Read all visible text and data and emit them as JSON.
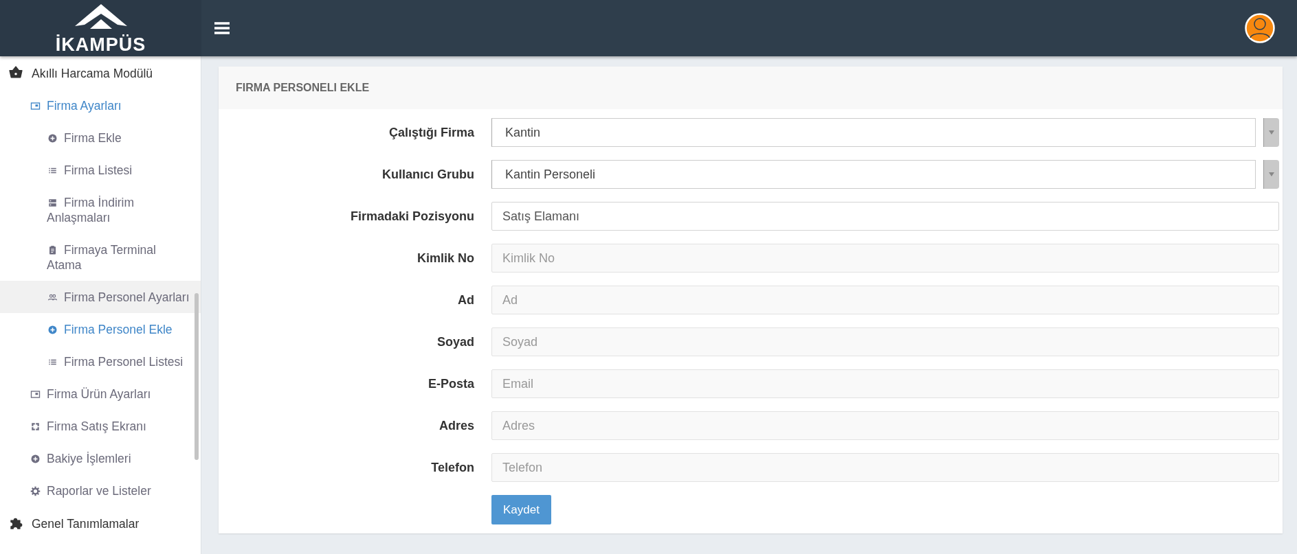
{
  "logo": {
    "text": "İKAMPÜS"
  },
  "sidebar": {
    "items": [
      {
        "label": "Akıllı Harcama Modülü",
        "active": false,
        "highlighted": false,
        "children": [
          {
            "label": "Firma Ayarları",
            "active": true,
            "highlighted": false,
            "children": [
              {
                "label": "Firma Ekle",
                "active": false,
                "highlighted": false
              },
              {
                "label": "Firma Listesi",
                "active": false,
                "highlighted": false
              },
              {
                "label": "Firma İndirim Anlaşmaları",
                "active": false,
                "highlighted": false
              },
              {
                "label": "Firmaya Terminal Atama",
                "active": false,
                "highlighted": false
              },
              {
                "label": "Firma Personel Ayarları",
                "active": false,
                "highlighted": true
              },
              {
                "label": "Firma Personel Ekle",
                "active": true,
                "highlighted": false
              },
              {
                "label": "Firma Personel Listesi",
                "active": false,
                "highlighted": false
              }
            ]
          },
          {
            "label": "Firma Ürün Ayarları",
            "active": false,
            "highlighted": false
          },
          {
            "label": "Firma Satış Ekranı",
            "active": false,
            "highlighted": false
          },
          {
            "label": "Bakiye İşlemleri",
            "active": false,
            "highlighted": false
          },
          {
            "label": "Raporlar ve Listeler",
            "active": false,
            "highlighted": false
          }
        ]
      },
      {
        "label": "Genel Tanımlamalar",
        "active": false,
        "highlighted": false
      }
    ]
  },
  "panel": {
    "title": "FIRMA PERSONELI EKLE",
    "fields": [
      {
        "kind": "select",
        "label": "Çalıştığı Firma",
        "value": "Kantin"
      },
      {
        "kind": "select",
        "label": "Kullanıcı Grubu",
        "value": "Kantin Personeli"
      },
      {
        "kind": "input",
        "label": "Firmadaki Pozisyonu",
        "value": "Satış Elamanı"
      },
      {
        "kind": "input",
        "label": "Kimlik No",
        "placeholder": "Kimlik No"
      },
      {
        "kind": "input",
        "label": "Ad",
        "placeholder": "Ad"
      },
      {
        "kind": "input",
        "label": "Soyad",
        "placeholder": "Soyad"
      },
      {
        "kind": "input",
        "label": "E-Posta",
        "placeholder": "Email"
      },
      {
        "kind": "input",
        "label": "Adres",
        "placeholder": "Adres"
      },
      {
        "kind": "input",
        "label": "Telefon",
        "placeholder": "Telefon"
      }
    ],
    "submit": "Kaydet"
  }
}
